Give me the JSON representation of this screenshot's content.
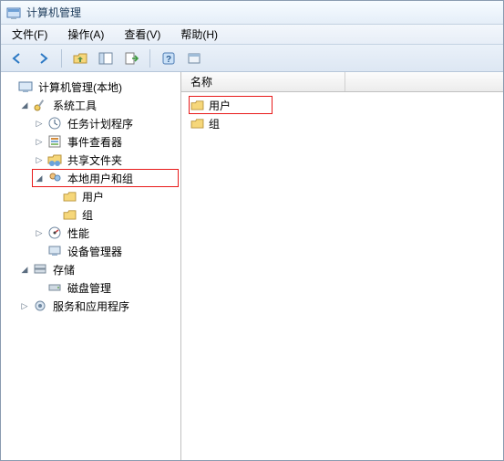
{
  "window": {
    "title": "计算机管理"
  },
  "menu": {
    "file": "文件(F)",
    "action": "操作(A)",
    "view": "查看(V)",
    "help": "帮助(H)"
  },
  "tree": {
    "root": "计算机管理(本地)",
    "systools": "系统工具",
    "scheduler": "任务计划程序",
    "eventviewer": "事件查看器",
    "sharedfolders": "共享文件夹",
    "localusers": "本地用户和组",
    "users": "用户",
    "groups": "组",
    "performance": "性能",
    "devicemgr": "设备管理器",
    "storage": "存储",
    "diskmgmt": "磁盘管理",
    "services": "服务和应用程序"
  },
  "right": {
    "header_name": "名称",
    "row_users": "用户",
    "row_groups": "组"
  }
}
